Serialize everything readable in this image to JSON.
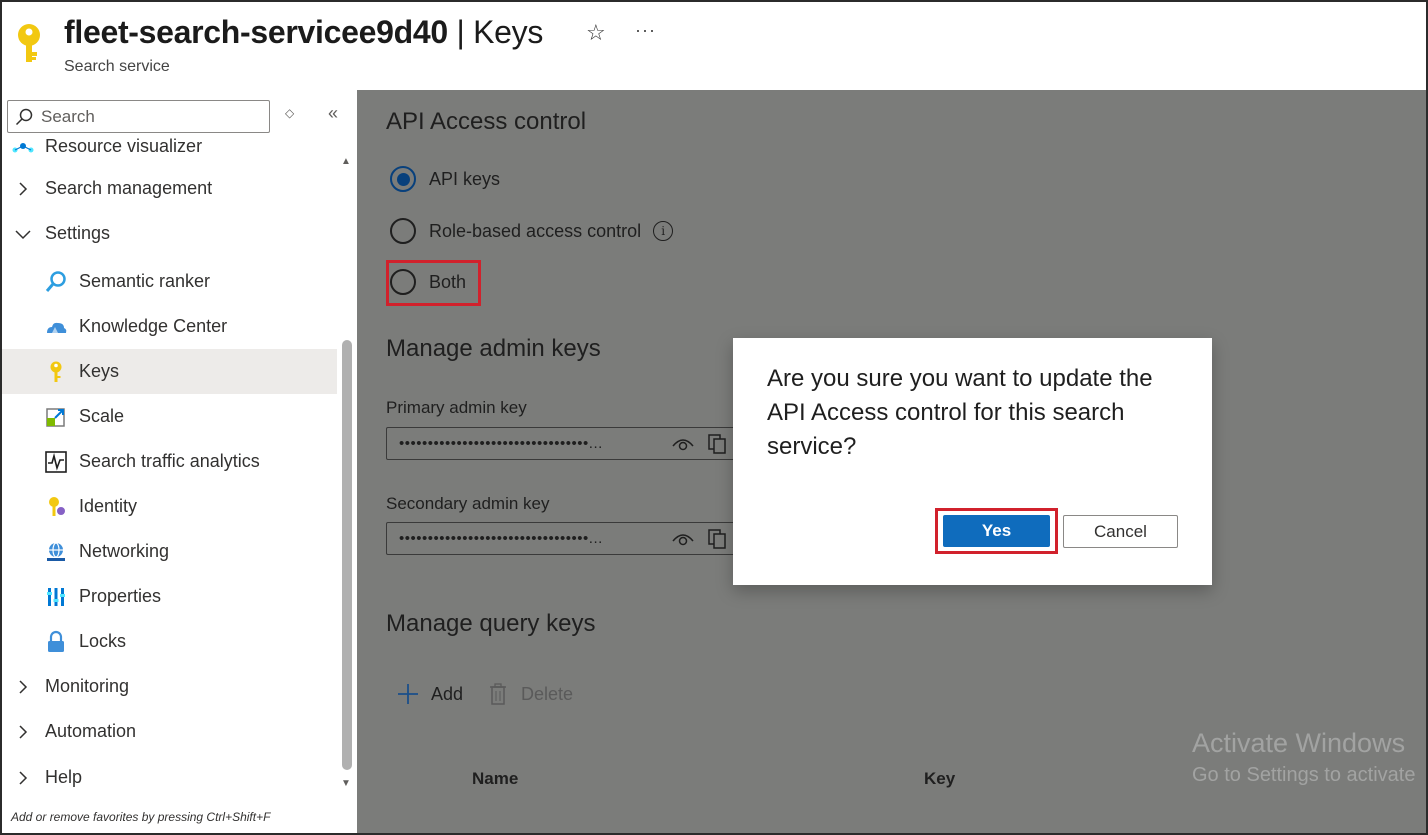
{
  "header": {
    "resource_name": "fleet-search-servicee9d40",
    "separator": " | ",
    "page": "Keys",
    "subtitle": "Search service",
    "star_icon": "star-icon",
    "more_icon": "more-icon"
  },
  "sidebar": {
    "search_placeholder": "Search",
    "items": [
      {
        "label": "Resource visualizer",
        "icon": "resource-visualizer-icon"
      },
      {
        "label": "Search management",
        "chevron": "right"
      },
      {
        "label": "Settings",
        "chevron": "down"
      },
      {
        "label": "Semantic ranker",
        "icon": "semantic-ranker-icon"
      },
      {
        "label": "Knowledge Center",
        "icon": "knowledge-center-icon"
      },
      {
        "label": "Keys",
        "icon": "key-icon",
        "selected": true
      },
      {
        "label": "Scale",
        "icon": "scale-icon"
      },
      {
        "label": "Search traffic analytics",
        "icon": "analytics-icon"
      },
      {
        "label": "Identity",
        "icon": "identity-icon"
      },
      {
        "label": "Networking",
        "icon": "networking-icon"
      },
      {
        "label": "Properties",
        "icon": "properties-icon"
      },
      {
        "label": "Locks",
        "icon": "lock-icon"
      },
      {
        "label": "Monitoring",
        "chevron": "right"
      },
      {
        "label": "Automation",
        "chevron": "right"
      },
      {
        "label": "Help",
        "chevron": "right"
      }
    ],
    "favorites_hint": "Add or remove favorites by pressing Ctrl+Shift+F"
  },
  "main": {
    "api_access_heading": "API Access control",
    "radio_options": [
      {
        "label": "API keys",
        "checked": true
      },
      {
        "label": "Role-based access control",
        "checked": false
      },
      {
        "label": "Both",
        "checked": false
      }
    ],
    "manage_admin_heading": "Manage admin keys",
    "primary_label": "Primary admin key",
    "primary_value": "•••••••••••••••••••••••••••••••••...",
    "secondary_label": "Secondary admin key",
    "secondary_value": "•••••••••••••••••••••••••••••••••...",
    "manage_query_heading": "Manage query keys",
    "add_label": "Add",
    "delete_label": "Delete",
    "columns": [
      "Name",
      "Key"
    ],
    "watermark_title": "Activate Windows",
    "watermark_sub": "Go to Settings to activate"
  },
  "dialog": {
    "message": "Are you sure you want to update the API Access control for this search service?",
    "yes_label": "Yes",
    "cancel_label": "Cancel"
  },
  "colors": {
    "primary_button": "#0f6cbd",
    "highlight_border": "#d1212c",
    "overlay": "#7b7c7a"
  }
}
